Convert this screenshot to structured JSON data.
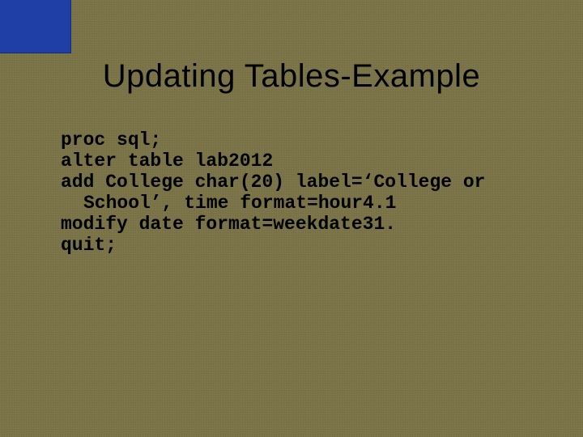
{
  "title": "Updating Tables-Example",
  "code": {
    "l1": "proc sql;",
    "l2": "alter table lab2012",
    "l3a": "add College char(20) label=‘College or",
    "l3b": "School’, time format=hour4.1",
    "l4": "modify date format=weekdate31.",
    "l5": "quit;"
  }
}
